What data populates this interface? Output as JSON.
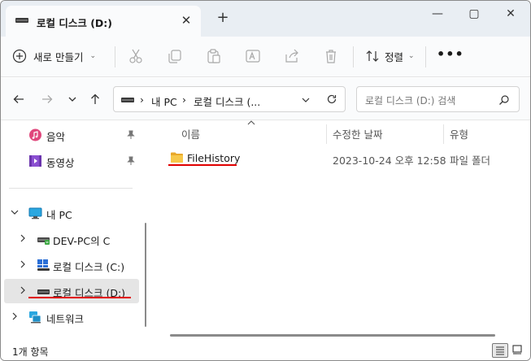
{
  "tab": {
    "title": "로컬 디스크 (D:)"
  },
  "toolbar": {
    "new_label": "새로 만들기",
    "sort_label": "정렬"
  },
  "address": {
    "crumbs": [
      "내 PC",
      "로컬 디스크 (..."
    ]
  },
  "search": {
    "placeholder": "로컬 디스크 (D:) 검색"
  },
  "sidebar": {
    "quick": [
      {
        "label": "음악",
        "icon": "music-icon"
      },
      {
        "label": "동영상",
        "icon": "video-icon"
      }
    ],
    "this_pc": {
      "label": "내 PC"
    },
    "drives": [
      {
        "label": "DEV-PC의 C",
        "icon": "network-drive-icon"
      },
      {
        "label": "로컬 디스크 (C:)",
        "icon": "windows-drive-icon"
      },
      {
        "label": "로컬 디스크 (D:)",
        "icon": "drive-icon",
        "selected": true
      }
    ],
    "network": {
      "label": "네트워크"
    }
  },
  "columns": {
    "name": "이름",
    "date": "수정한 날짜",
    "type": "유형"
  },
  "files": [
    {
      "name": "FileHistory",
      "date": "2023-10-24 오후 12:58",
      "type": "파일 폴더"
    }
  ],
  "status": {
    "count": "1개 항목"
  },
  "colors": {
    "accent": "#0067c0",
    "highlight_underline": "#e00000",
    "folder": "#f4c542"
  }
}
